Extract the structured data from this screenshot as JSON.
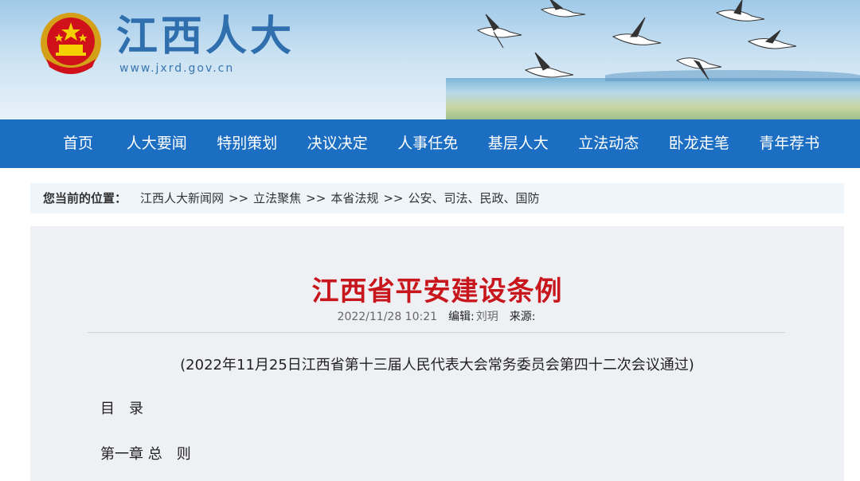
{
  "header": {
    "site_title": "江西人大",
    "site_url": "www.jxrd.gov.cn"
  },
  "nav": {
    "items": [
      {
        "label": "首页"
      },
      {
        "label": "人大要闻"
      },
      {
        "label": "特别策划"
      },
      {
        "label": "决议决定"
      },
      {
        "label": "人事任免"
      },
      {
        "label": "基层人大"
      },
      {
        "label": "立法动态"
      },
      {
        "label": "卧龙走笔"
      },
      {
        "label": "青年荐书"
      }
    ]
  },
  "breadcrumb": {
    "lead": "您当前的位置：",
    "items": [
      "江西人大新闻网",
      "立法聚焦",
      "本省法规",
      "公安、司法、民政、国防"
    ],
    "separator": ">>"
  },
  "article": {
    "title": "江西省平安建设条例",
    "datetime": "2022/11/28 10:21",
    "editor_label": "编辑:",
    "editor": "刘玥",
    "source_label": "来源:",
    "source": "",
    "note": "(2022年11月25日江西省第十三届人民代表大会常务委员会第四十二次会议通过)",
    "toc_heading": "目　录",
    "chapter1": "第一章 总　则"
  },
  "colors": {
    "nav_bg": "#1b6ec2",
    "title_red": "#c8161d",
    "site_title_blue": "#2f6fae"
  }
}
